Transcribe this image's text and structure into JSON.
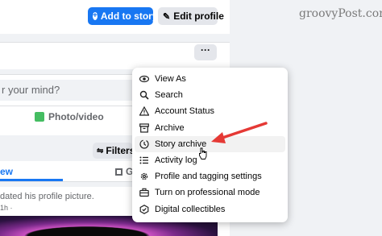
{
  "header": {
    "add_story_label": "Add to story",
    "edit_profile_label": "Edit profile",
    "watermark": "groovyPost.com"
  },
  "composer": {
    "placeholder": "r your mind?",
    "photo_label": "Photo/video"
  },
  "posts_bar": {
    "filters_label": "Filters",
    "tab_view_label": "ew",
    "tab_grid_label": "Gr"
  },
  "post": {
    "text": "dated his profile picture.",
    "date": "1h ·"
  },
  "menu": {
    "items": [
      {
        "label": "View As",
        "icon": "eye-icon"
      },
      {
        "label": "Search",
        "icon": "search-icon"
      },
      {
        "label": "Account Status",
        "icon": "warning-icon"
      },
      {
        "label": "Archive",
        "icon": "archive-icon"
      },
      {
        "label": "Story archive",
        "icon": "story-clock-icon"
      },
      {
        "label": "Activity log",
        "icon": "list-icon"
      },
      {
        "label": "Profile and tagging settings",
        "icon": "gear-icon"
      },
      {
        "label": "Turn on professional mode",
        "icon": "briefcase-icon"
      },
      {
        "label": "Digital collectibles",
        "icon": "badge-icon"
      }
    ]
  },
  "colors": {
    "accent": "#1877f2",
    "arrow": "#e53935"
  }
}
